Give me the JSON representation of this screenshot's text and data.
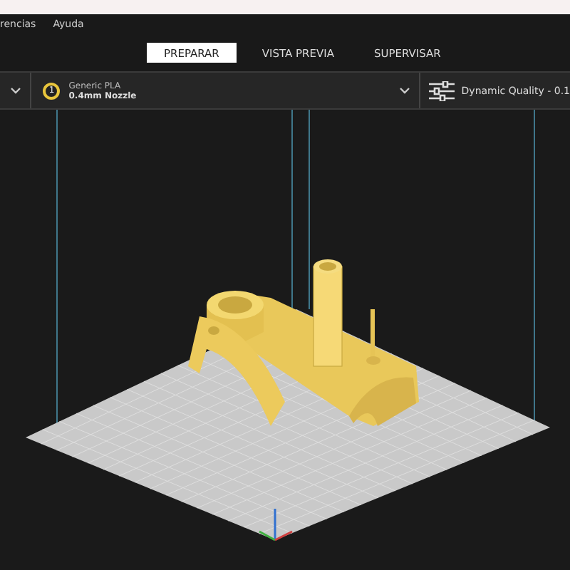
{
  "menu": [
    {
      "label": "rencias"
    },
    {
      "label": "Ayuda"
    }
  ],
  "stages": [
    {
      "label": "PREPARAR",
      "selected": true
    },
    {
      "label": "VISTA PREVIA",
      "selected": false
    },
    {
      "label": "SUPERVISAR",
      "selected": false
    }
  ],
  "toolbar": {
    "extruder": "1",
    "material": "Generic PLA",
    "nozzle": "0.4mm Nozzle",
    "profile": "Dynamic Quality - 0.1"
  }
}
